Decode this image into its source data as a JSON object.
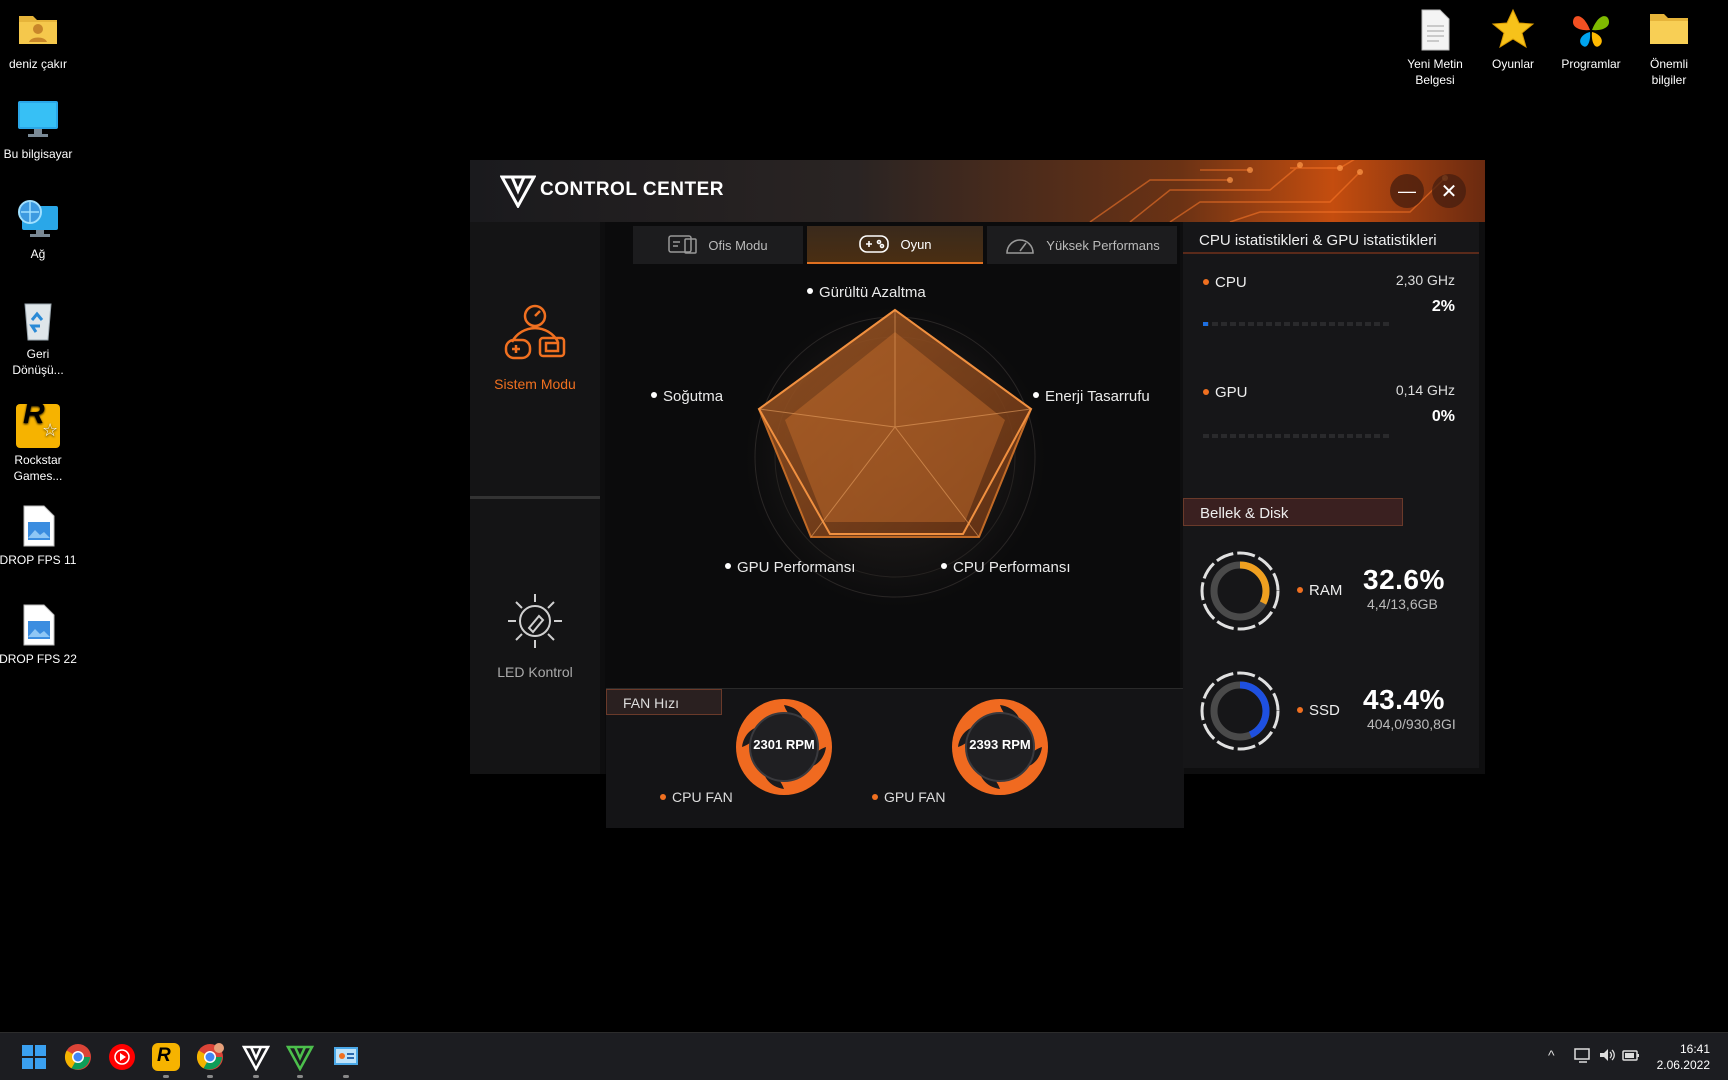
{
  "desktop": {
    "left_icons": [
      {
        "label": "deniz çakır",
        "icon": "user-folder-icon"
      },
      {
        "label": "Bu bilgisayar",
        "icon": "monitor-icon"
      },
      {
        "label": "Ağ",
        "icon": "network-icon"
      },
      {
        "label": "Geri Dönüşü...",
        "icon": "recycle-bin-icon"
      },
      {
        "label": "Rockstar Games...",
        "icon": "rockstar-icon"
      },
      {
        "label": "DROP FPS 11",
        "icon": "image-file-icon"
      },
      {
        "label": "DROP FPS 22",
        "icon": "image-file-icon"
      }
    ],
    "right_icons": [
      {
        "label": "Yeni Metin Belgesi",
        "icon": "text-document-icon"
      },
      {
        "label": "Oyunlar",
        "icon": "star-icon"
      },
      {
        "label": "Programlar",
        "icon": "msn-butterfly-icon"
      },
      {
        "label": "Önemli bilgiler",
        "icon": "folder-icon"
      }
    ]
  },
  "window": {
    "title": "CONTROL CENTER",
    "minimize_label": "—",
    "close_label": "✕"
  },
  "sidebar": {
    "items": [
      {
        "label": "Sistem Modu",
        "icon": "system-mode-icon",
        "active": true
      },
      {
        "label": "LED Kontrol",
        "icon": "led-control-icon",
        "active": false
      }
    ]
  },
  "mode_tabs": [
    {
      "label": "Ofis Modu",
      "icon": "office-mode-icon",
      "active": false
    },
    {
      "label": "Oyun",
      "icon": "gamepad-icon",
      "active": true
    },
    {
      "label": "Yüksek Performans",
      "icon": "speedometer-icon",
      "active": false
    }
  ],
  "radar": {
    "axes": [
      "Gürültü Azaltma",
      "Enerji Tasarrufu",
      "CPU Performansı",
      "GPU Performansı",
      "Soğutma"
    ]
  },
  "fan": {
    "header": "FAN Hızı",
    "cpu": {
      "rpm": "2301 RPM",
      "label": "CPU FAN"
    },
    "gpu": {
      "rpm": "2393 RPM",
      "label": "GPU FAN"
    }
  },
  "stats": {
    "header": "CPU istatistikleri & GPU istatistikleri",
    "cpu": {
      "name": "CPU",
      "freq": "2,30 GHz",
      "usage": "2%",
      "usage_value": 0.02
    },
    "gpu": {
      "name": "GPU",
      "freq": "0,14 GHz",
      "usage": "0%",
      "usage_value": 0.0
    }
  },
  "memory": {
    "header": "Bellek & Disk",
    "ram": {
      "name": "RAM",
      "percent": "32.6%",
      "detail": "4,4/13,6GB",
      "value": 0.326
    },
    "ssd": {
      "name": "SSD",
      "percent": "43.4%",
      "detail": "404,0/930,8GI",
      "value": 0.434
    }
  },
  "taskbar": {
    "apps": [
      "windows-start-icon",
      "chrome-icon",
      "youtube-music-icon",
      "rockstar-icon",
      "chrome-profile-icon",
      "control-center-icon",
      "v-app-icon",
      "control-panel-icon"
    ],
    "time": "16:41",
    "date": "2.06.2022"
  },
  "colors": {
    "accent": "#f07020",
    "cpu_bar": "#1e6fe0",
    "ram_ring": "#f0a020",
    "ssd_ring": "#1e50e0"
  }
}
